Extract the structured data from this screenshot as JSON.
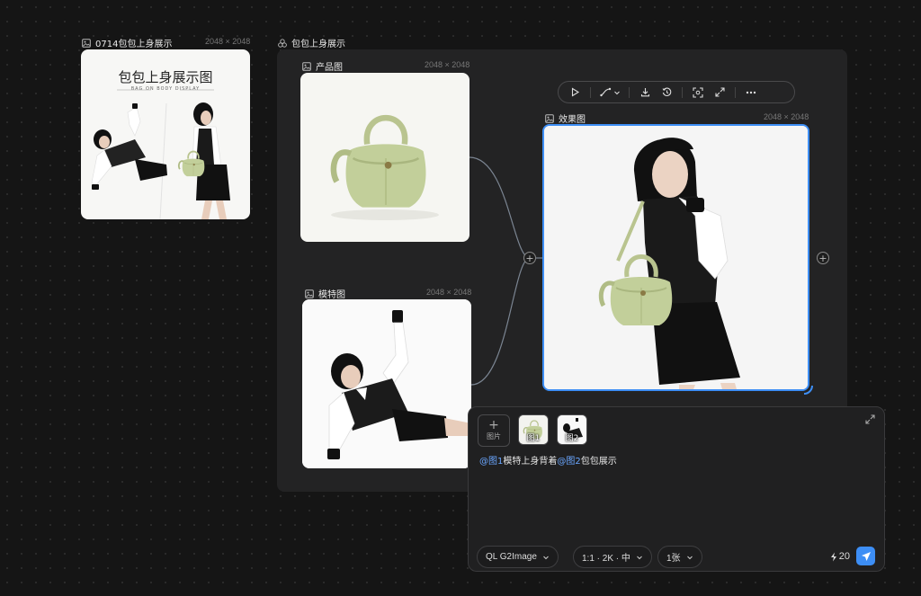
{
  "standalone_node": {
    "title": "0714包包上身展示",
    "size": "2048 × 2048"
  },
  "poster": {
    "heading": "包包上身展示图",
    "subheading": "BAG ON BODY DISPLAY"
  },
  "group": {
    "title": "包包上身展示"
  },
  "product_node": {
    "title": "产品图",
    "size": "2048 × 2048"
  },
  "model_node": {
    "title": "模特图",
    "size": "2048 × 2048"
  },
  "result_node": {
    "title": "效果图",
    "size": "2048 × 2048"
  },
  "toolbar": {
    "icons": [
      "play-icon",
      "curve-icon",
      "chevron-down-icon",
      "download-icon",
      "history-icon",
      "focus-icon",
      "expand-icon",
      "more-icon"
    ]
  },
  "prompt": {
    "add_image_label": "图片",
    "thumb1_label": "图1",
    "thumb2_label": "图2",
    "text": {
      "mention1": "@图1",
      "part1": "模特上身背着",
      "mention2": "@图2",
      "part2": "包包展示"
    },
    "model_select": "QL G2Image",
    "ratio_select": "1:1 · 2K · 中",
    "count_select": "1张",
    "credits": "20"
  },
  "colors": {
    "accent": "#3d8ef5",
    "mention": "#6aa6ff",
    "bag_green": "#c2cf9a"
  }
}
